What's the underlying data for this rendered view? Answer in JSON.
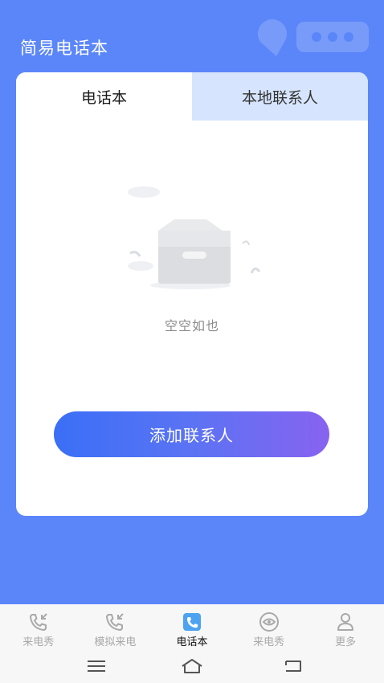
{
  "app": {
    "title": "简易电话本"
  },
  "tabs": [
    {
      "label": "电话本",
      "active": true
    },
    {
      "label": "本地联系人",
      "active": false
    }
  ],
  "empty_state": {
    "text": "空空如也",
    "icon": "empty-box-icon"
  },
  "add_button": {
    "label": "添加联系人"
  },
  "bottom_nav": {
    "items": [
      {
        "label": "来电秀",
        "icon": "phone-incoming-icon",
        "active": false
      },
      {
        "label": "模拟来电",
        "icon": "phone-incoming-icon",
        "active": false
      },
      {
        "label": "电话本",
        "icon": "phonebook-icon",
        "active": true
      },
      {
        "label": "来电秀",
        "icon": "eye-icon",
        "active": false
      },
      {
        "label": "更多",
        "icon": "person-icon",
        "active": false
      }
    ]
  },
  "system_nav": {
    "icons": [
      "menu-icon",
      "home-icon",
      "back-icon"
    ]
  },
  "colors": {
    "background": "#5b86f9",
    "tab_inactive": "#d6e5fd",
    "button_gradient_start": "#3a6ff6",
    "button_gradient_end": "#8763f0",
    "nav_active_icon": "#4da3f0"
  }
}
